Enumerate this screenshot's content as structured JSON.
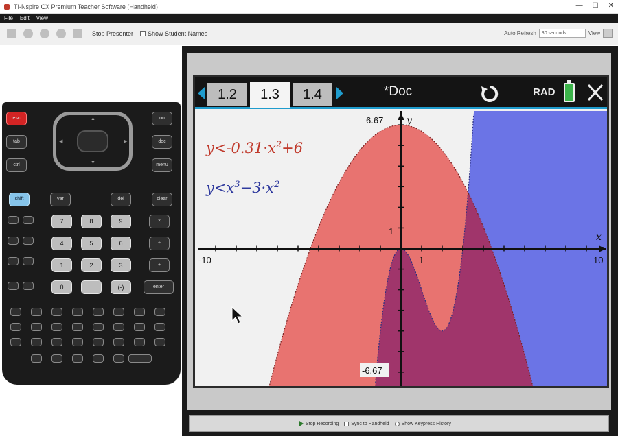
{
  "window": {
    "title": "TI-Nspire CX Premium Teacher Software (Handheld)",
    "min": "—",
    "max": "☐",
    "close": "✕"
  },
  "menu": [
    {
      "label": "File"
    },
    {
      "label": "Edit"
    },
    {
      "label": "View"
    }
  ],
  "toolbar": {
    "stop_presenter": "Stop Presenter",
    "show_student_names": "Show Student Names",
    "auto_refresh_label": "Auto Refresh",
    "auto_refresh_value": "30 seconds",
    "view_label": "View"
  },
  "handheld": {
    "keys": {
      "esc": "esc",
      "tab": "tab",
      "ctrl": "ctrl",
      "shift": "shift",
      "del": "del",
      "menu": "menu",
      "doc": "doc",
      "var": "var",
      "clear": "clear",
      "on": "on",
      "enter": "enter",
      "d7": "7",
      "d8": "8",
      "d9": "9",
      "d4": "4",
      "d5": "5",
      "d6": "6",
      "d1": "1",
      "d2": "2",
      "d3": "3",
      "d0": "0",
      "dot": ".",
      "neg": "(-)",
      "plus": "+",
      "minus": "−",
      "times": "×",
      "div": "÷"
    }
  },
  "tabs": [
    {
      "label": "1.2"
    },
    {
      "label": "1.3"
    },
    {
      "label": "1.4"
    }
  ],
  "doc_title": "*Doc",
  "angle_mode": "RAD",
  "graph": {
    "equations": {
      "eq1": {
        "lhs": "y<-0.31·x",
        "exp": "2",
        "rhs": "+6"
      },
      "eq2": {
        "lhs": "y<x",
        "exp1": "3",
        "mid": "−3·x",
        "exp2": "2"
      }
    },
    "axes": {
      "x_min": "-10",
      "x_max": "10",
      "y_max": "6.67",
      "y_min": "-6.67",
      "x_tick": "1",
      "y_tick": "1",
      "y_label": "y",
      "x_label": "x"
    },
    "colors": {
      "region1": "#e87370",
      "region2": "#6b74e6",
      "overlap": "#a0356b"
    }
  },
  "bottom": {
    "stop_recording": "Stop Recording",
    "sync_handheld": "Sync to Handheld",
    "show_keypress": "Show Keypress History"
  }
}
